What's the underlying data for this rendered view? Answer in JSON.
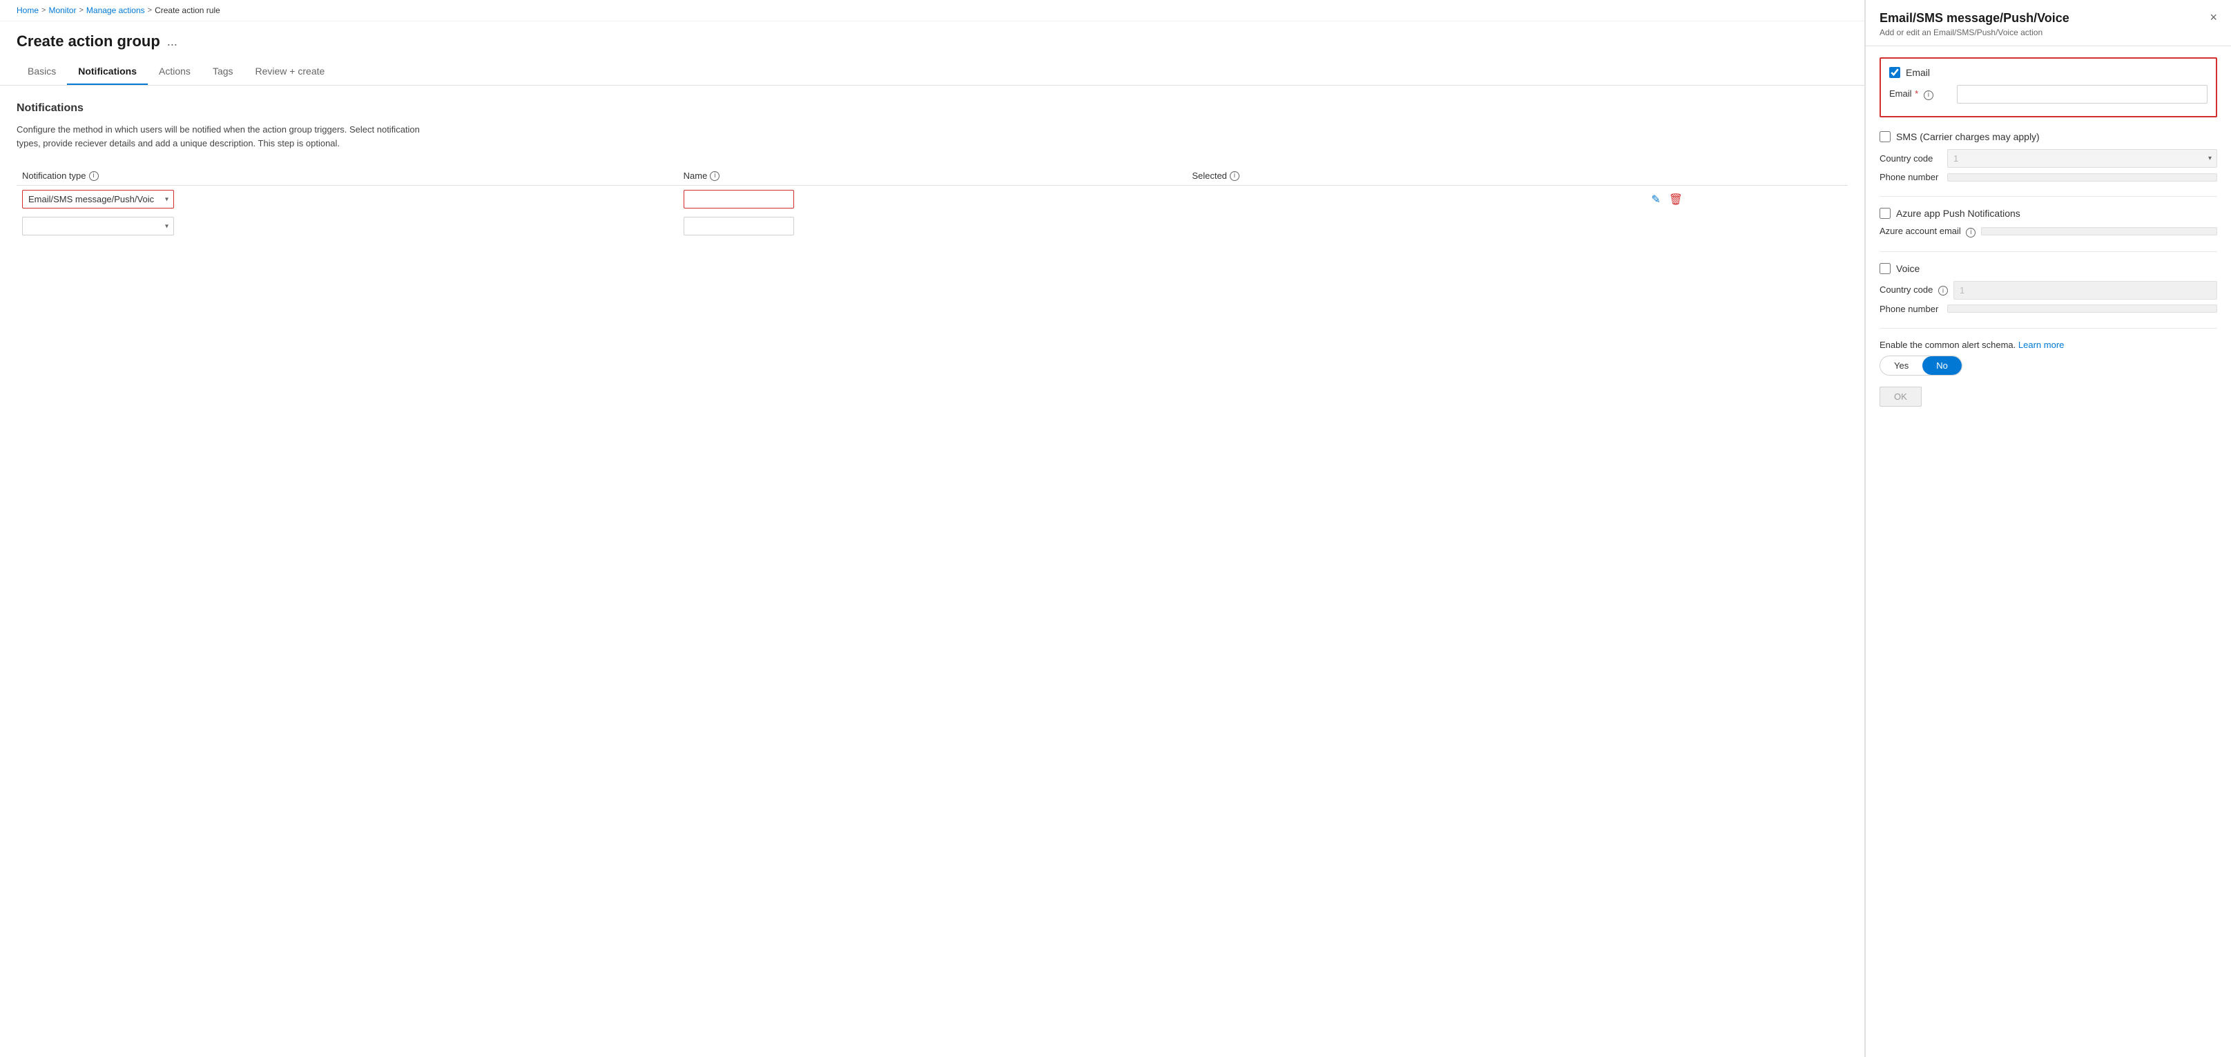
{
  "breadcrumb": {
    "items": [
      "Home",
      "Monitor",
      "Manage actions",
      "Create action rule"
    ],
    "separator": ">"
  },
  "page": {
    "title": "Create action group",
    "menu_icon": "..."
  },
  "tabs": [
    {
      "id": "basics",
      "label": "Basics",
      "active": false
    },
    {
      "id": "notifications",
      "label": "Notifications",
      "active": true
    },
    {
      "id": "actions",
      "label": "Actions",
      "active": false
    },
    {
      "id": "tags",
      "label": "Tags",
      "active": false
    },
    {
      "id": "review_create",
      "label": "Review + create",
      "active": false
    }
  ],
  "notifications_section": {
    "title": "Notifications",
    "description": "Configure the method in which users will be notified when the action group triggers. Select notification types, provide reciever details and add a unique description. This step is optional.",
    "table": {
      "columns": [
        {
          "id": "type",
          "label": "Notification type",
          "has_info": true
        },
        {
          "id": "name",
          "label": "Name",
          "has_info": true
        },
        {
          "id": "selected",
          "label": "Selected",
          "has_info": true
        },
        {
          "id": "actions",
          "label": ""
        }
      ],
      "rows": [
        {
          "type_value": "Email/SMS message/Push/Voice",
          "type_highlighted": true,
          "name_value": "",
          "name_highlighted": true,
          "selected_value": "",
          "has_edit": true,
          "has_delete": true
        },
        {
          "type_value": "",
          "type_highlighted": false,
          "name_value": "",
          "name_highlighted": false,
          "selected_value": "",
          "has_edit": false,
          "has_delete": false
        }
      ]
    }
  },
  "panel": {
    "title": "Email/SMS message/Push/Voice",
    "subtitle": "Add or edit an Email/SMS/Push/Voice action",
    "close_label": "×",
    "email": {
      "checked": true,
      "label": "Email",
      "field_label": "Email",
      "required": true,
      "placeholder": ""
    },
    "sms": {
      "checked": false,
      "label": "SMS (Carrier charges may apply)",
      "country_code_label": "Country code",
      "country_code_value": "1",
      "phone_label": "Phone number",
      "phone_value": ""
    },
    "azure_push": {
      "checked": false,
      "label": "Azure app Push Notifications",
      "account_email_label": "Azure account email"
    },
    "voice": {
      "checked": false,
      "label": "Voice",
      "country_code_label": "Country code",
      "country_code_value": "1",
      "phone_label": "Phone number",
      "phone_value": ""
    },
    "alert_schema": {
      "label": "Enable the common alert schema.",
      "learn_more": "Learn more",
      "yes_label": "Yes",
      "no_label": "No",
      "selected": "No"
    },
    "ok_label": "OK"
  }
}
